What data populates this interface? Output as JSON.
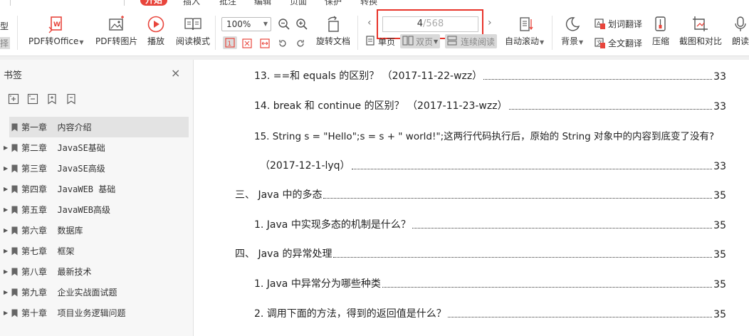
{
  "menu_tabs": [
    {
      "label": "开始",
      "active": true
    },
    {
      "label": "插入",
      "active": false
    },
    {
      "label": "批注",
      "active": false
    },
    {
      "label": "编辑",
      "active": false
    },
    {
      "label": "页面",
      "active": false
    },
    {
      "label": "保护",
      "active": false
    },
    {
      "label": "转换",
      "active": false
    }
  ],
  "ribbon": {
    "cut_left_top": "型",
    "cut_left_bottom": "择",
    "pdf_to_office": "PDF转Office",
    "pdf_to_image": "PDF转图片",
    "play": "播放",
    "read_mode": "阅读模式",
    "zoom_value": "100%",
    "rotate_doc": "旋转文档",
    "page_current": "4",
    "page_total": "/568",
    "single_page": "单页",
    "double_page": "双页",
    "continuous_read": "连续阅读",
    "auto_scroll": "自动滚动",
    "background": "背景",
    "word_translate": "划词翻译",
    "full_translate": "全文翻译",
    "compress": "压缩",
    "screenshot_compare": "截图和对比",
    "read_aloud": "朗读"
  },
  "icons": {
    "pdf_to_office": "pdf-office-icon",
    "pdf_to_image": "image-icon",
    "play": "play-icon",
    "read_mode": "book-icon",
    "zoom_out": "zoom-out-icon",
    "zoom_in": "zoom-in-icon",
    "rotate": "rotate-icon",
    "auto_scroll": "auto-scroll-icon",
    "background": "moon-icon",
    "compress": "compress-icon",
    "screenshot": "screenshot-icon",
    "read_aloud": "speaker-icon",
    "bookmark": "bookmark-icon"
  },
  "colors": {
    "accent_red": "#e8453c",
    "highlight_frame": "#e8342a",
    "sidebar_bg": "#f7f7f7",
    "selected_bg": "#e3e3e3"
  },
  "sidebar": {
    "title": "书签",
    "close": "×",
    "items": [
      {
        "label": "第一章  内容介绍",
        "selected": true,
        "expandable": false
      },
      {
        "label": "第二章  JavaSE基础",
        "selected": false,
        "expandable": true
      },
      {
        "label": "第三章  JavaSE高级",
        "selected": false,
        "expandable": true
      },
      {
        "label": "第四章  JavaWEB 基础",
        "selected": false,
        "expandable": true
      },
      {
        "label": "第五章  JavaWEB高级",
        "selected": false,
        "expandable": true
      },
      {
        "label": "第六章  数据库",
        "selected": false,
        "expandable": true
      },
      {
        "label": "第七章  框架",
        "selected": false,
        "expandable": true
      },
      {
        "label": "第八章  最新技术",
        "selected": false,
        "expandable": true
      },
      {
        "label": "第九章  企业实战面试题",
        "selected": false,
        "expandable": true
      },
      {
        "label": "第十章  项目业务逻辑问题",
        "selected": false,
        "expandable": true
      }
    ]
  },
  "toc": [
    {
      "text": "13. ==和 equals 的区别？ （2017-11-22-wzz）",
      "page": "33"
    },
    {
      "text": "14. break 和 continue 的区别？ （2017-11-23-wzz）",
      "page": "33"
    },
    {
      "text": "15. String s = \"Hello\";s = s + \" world!\";这两行代码执行后，原始的 String 对象中的内容到底变了没有?",
      "page": ""
    },
    {
      "text": "（2017-12-1-lyq）",
      "page": "33"
    },
    {
      "text": "三、 Java 中的多态",
      "page": "35"
    },
    {
      "text": "1. Java 中实现多态的机制是什么？",
      "page": "35"
    },
    {
      "text": "四、 Java 的异常处理",
      "page": "35"
    },
    {
      "text": "1. Java 中异常分为哪些种类",
      "page": "35"
    },
    {
      "text": "2. 调用下面的方法，得到的返回值是什么？",
      "page": "35"
    }
  ]
}
